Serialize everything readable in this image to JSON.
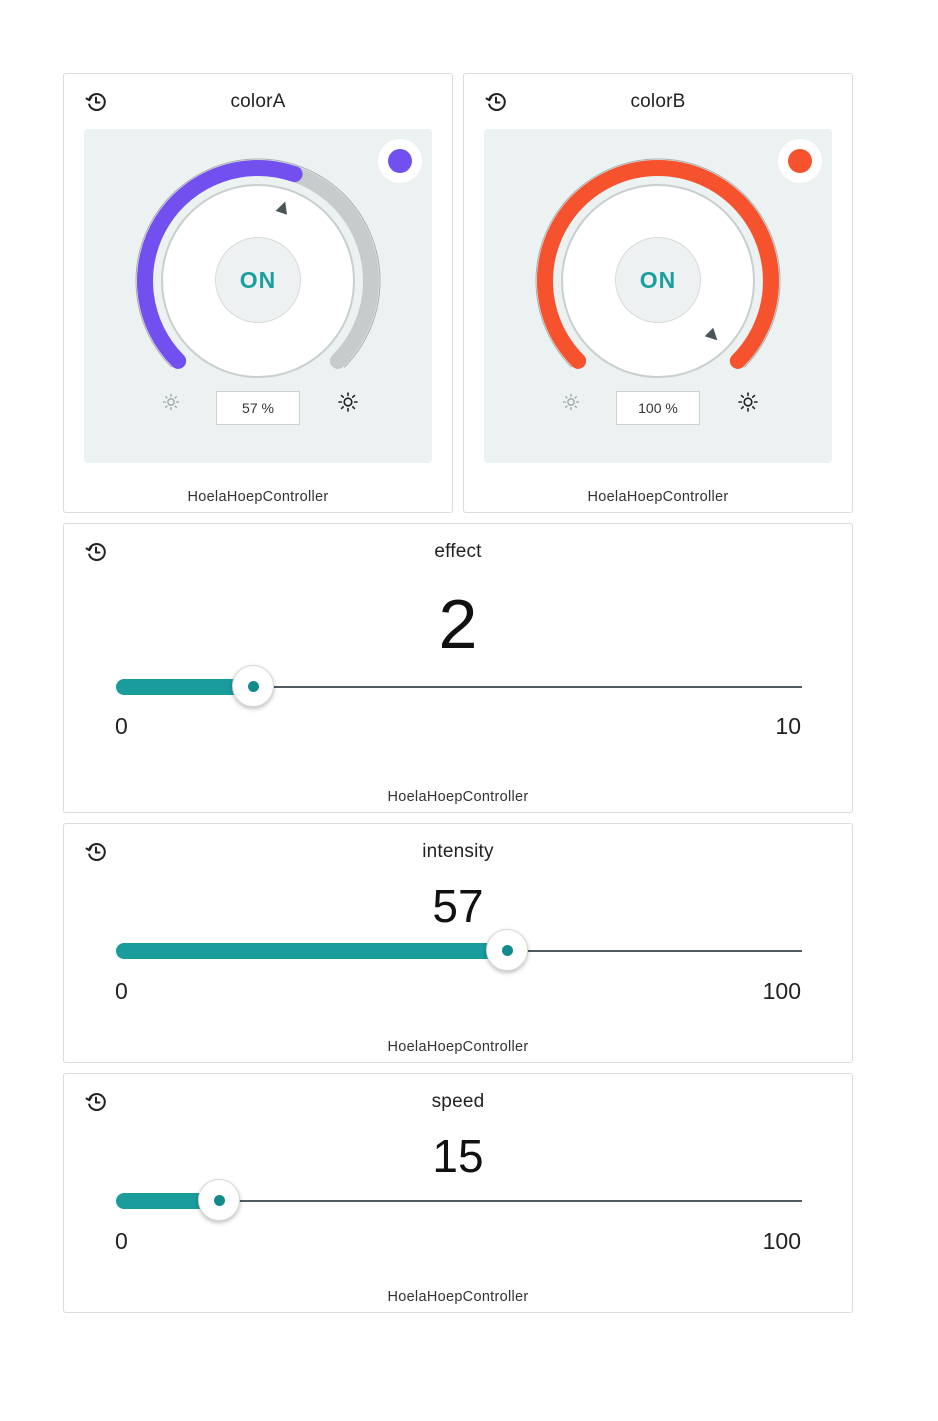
{
  "colors": {
    "accent": "#1a9c9c",
    "panel_bg": "#ecf1f1",
    "track_gray": "#c6cbcb"
  },
  "widgets": [
    {
      "title": "colorA",
      "device": "HoelaHoepController",
      "state_label": "ON",
      "brightness": 57,
      "brightness_text": "57 %",
      "color": "#7250f0",
      "icon": "history-icon"
    },
    {
      "title": "colorB",
      "device": "HoelaHoepController",
      "state_label": "ON",
      "brightness": 100,
      "brightness_text": "100 %",
      "color": "#f6522e",
      "icon": "history-icon"
    }
  ],
  "sliders": [
    {
      "title": "effect",
      "value": 2,
      "value_text": "2",
      "min": 0,
      "max": 10,
      "min_text": "0",
      "max_text": "10",
      "device": "HoelaHoepController",
      "icon": "history-icon"
    },
    {
      "title": "intensity",
      "value": 57,
      "value_text": "57",
      "min": 0,
      "max": 100,
      "min_text": "0",
      "max_text": "100",
      "device": "HoelaHoepController",
      "icon": "history-icon"
    },
    {
      "title": "speed",
      "value": 15,
      "value_text": "15",
      "min": 0,
      "max": 100,
      "min_text": "0",
      "max_text": "100",
      "device": "HoelaHoepController",
      "icon": "history-icon"
    }
  ]
}
